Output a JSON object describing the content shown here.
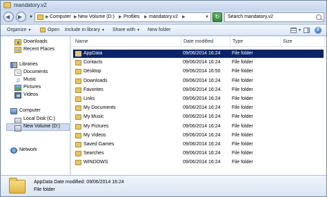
{
  "window": {
    "title": "mandatory.v2"
  },
  "address": {
    "breadcrumbs": [
      "Computer",
      "New Volume (D:)",
      "Profiles",
      "mandatory.v2"
    ],
    "search_placeholder": "Search mandatory.v2"
  },
  "toolbar": {
    "organize": "Organize",
    "open": "Open",
    "include_in_library": "Include in library",
    "share_with": "Share with",
    "new_folder": "New folder"
  },
  "nav": {
    "downloads": "Downloads",
    "recent_places": "Recent Places",
    "libraries": "Libraries",
    "documents": "Documents",
    "music": "Music",
    "pictures": "Pictures",
    "videos": "Videos",
    "computer": "Computer",
    "local_disk": "Local Disk (C:)",
    "new_volume": "New Volume (D:)",
    "network": "Network"
  },
  "columns": {
    "name": "Name",
    "date": "Date modified",
    "type": "Type",
    "size": "Size"
  },
  "files": [
    {
      "name": "AppData",
      "date": "09/06/2014 16:24",
      "type": "File folder",
      "selected": true
    },
    {
      "name": "Contacts",
      "date": "09/06/2014 16:24",
      "type": "File folder"
    },
    {
      "name": "Desktop",
      "date": "09/06/2014 16:50",
      "type": "File folder"
    },
    {
      "name": "Downloads",
      "date": "09/06/2014 16:24",
      "type": "File folder"
    },
    {
      "name": "Favorites",
      "date": "09/06/2014 16:24",
      "type": "File folder"
    },
    {
      "name": "Links",
      "date": "09/06/2014 16:24",
      "type": "File folder"
    },
    {
      "name": "My Documents",
      "date": "09/06/2014 16:24",
      "type": "File folder"
    },
    {
      "name": "My Music",
      "date": "09/06/2014 16:24",
      "type": "File folder"
    },
    {
      "name": "My Pictures",
      "date": "09/06/2014 16:24",
      "type": "File folder"
    },
    {
      "name": "My Videos",
      "date": "09/06/2014 16:24",
      "type": "File folder"
    },
    {
      "name": "Saved Games",
      "date": "09/06/2014 16:24",
      "type": "File folder"
    },
    {
      "name": "Searches",
      "date": "09/06/2014 16:24",
      "type": "File folder"
    },
    {
      "name": "WINDOWS",
      "date": "09/06/2014 16:24",
      "type": "File folder"
    }
  ],
  "details": {
    "name": "AppData",
    "date_label": "Date modified:",
    "date_value": "09/06/2014 16:24",
    "type": "File folder"
  },
  "icons": {
    "back": "back-arrow-icon",
    "forward": "forward-arrow-icon",
    "refresh": "refresh-icon",
    "search": "search-icon",
    "help": "help-icon"
  },
  "colors": {
    "selection": "#0a246a",
    "folder": "#e9c55c"
  }
}
